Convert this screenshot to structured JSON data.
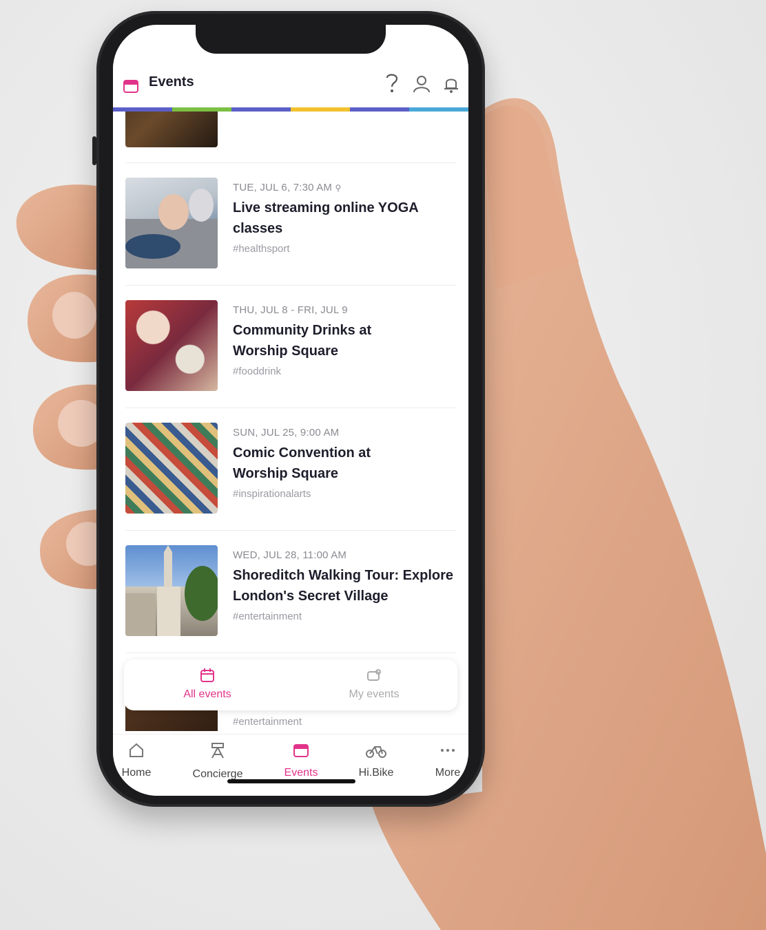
{
  "app": {
    "title": "Events"
  },
  "header_icons": [
    "help-icon",
    "profile-icon",
    "notification-bell-icon"
  ],
  "colors": {
    "accent": "#e2338a",
    "stripe": [
      "#5b5fc7",
      "#7bc043",
      "#5b5fc7",
      "#f2c12e",
      "#5b5fc7",
      "#4aa8d8"
    ]
  },
  "events": [
    {
      "date": "TUE, JUL 6, 7:30 AM",
      "title": "Live streaming online YOGA classes",
      "tag": "#healthsport",
      "has_pin": true
    },
    {
      "date": "THU, JUL 8 - FRI, JUL 9",
      "title": "Community Drinks at Worship Square",
      "tag": "#fooddrink"
    },
    {
      "date": "SUN, JUL 25, 9:00 AM",
      "title": "Comic Convention at Worship Square",
      "tag": "#inspirationalarts"
    },
    {
      "date": "WED, JUL 28, 11:00 AM",
      "title": "Shoreditch Walking Tour: Explore London's Secret Village",
      "tag": "#entertainment"
    }
  ],
  "peek_tag": "#entertainment",
  "segment": {
    "all": "All events",
    "mine": "My events",
    "active": "all"
  },
  "tabs": [
    {
      "label": "Home",
      "icon": "home-icon"
    },
    {
      "label": "Concierge",
      "icon": "concierge-icon"
    },
    {
      "label": "Events",
      "icon": "calendar-icon",
      "active": true
    },
    {
      "label": "Hi.Bike",
      "icon": "bike-icon"
    },
    {
      "label": "More",
      "icon": "more-icon"
    }
  ]
}
